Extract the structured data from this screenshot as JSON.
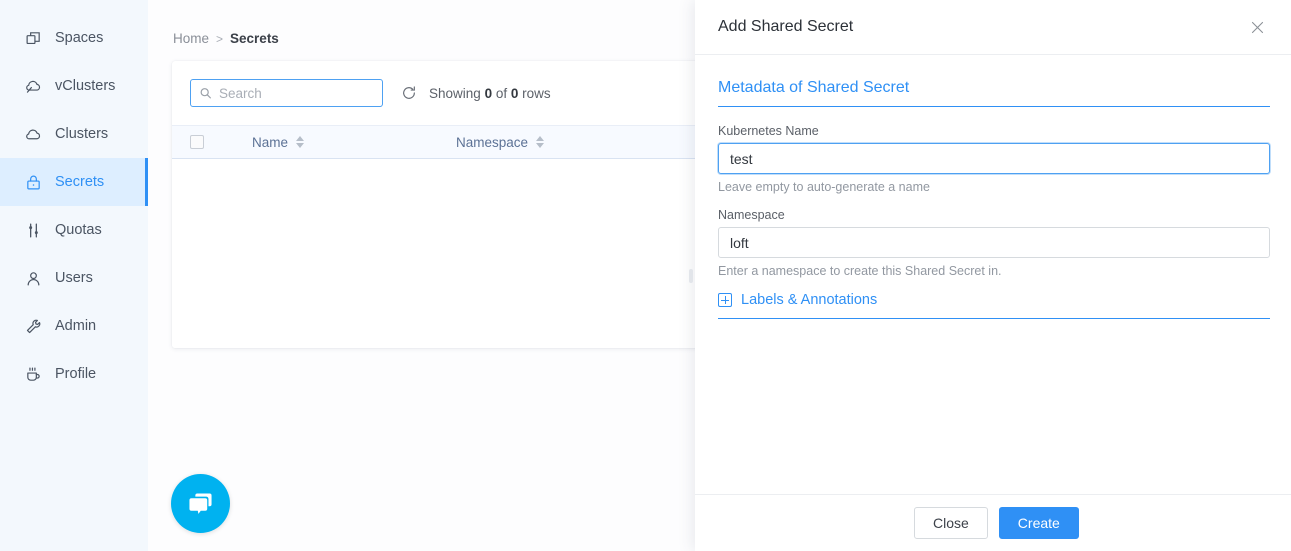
{
  "sidebar": {
    "items": [
      {
        "label": "Spaces",
        "icon": "spaces-icon",
        "active": false
      },
      {
        "label": "vClusters",
        "icon": "vclusters-icon",
        "active": false
      },
      {
        "label": "Clusters",
        "icon": "clusters-icon",
        "active": false
      },
      {
        "label": "Secrets",
        "icon": "lock-icon",
        "active": true
      },
      {
        "label": "Quotas",
        "icon": "sliders-icon",
        "active": false
      },
      {
        "label": "Users",
        "icon": "user-icon",
        "active": false
      },
      {
        "label": "Admin",
        "icon": "wrench-icon",
        "active": false
      },
      {
        "label": "Profile",
        "icon": "coffee-icon",
        "active": false
      }
    ],
    "active_index": 3
  },
  "breadcrumb": {
    "home": "Home",
    "separator": ">",
    "current": "Secrets"
  },
  "toolbar": {
    "search_placeholder": "Search",
    "search_value": "",
    "search_icon": "search-icon",
    "refresh_icon": "refresh-icon",
    "showing_prefix": "Showing",
    "showing_count": "0",
    "showing_of": "of",
    "showing_total": "0",
    "showing_suffix": "rows"
  },
  "table": {
    "columns": [
      {
        "label": "Name"
      },
      {
        "label": "Namespace"
      }
    ],
    "rows": []
  },
  "chat": {
    "icon": "chat-bubble-icon"
  },
  "drawer": {
    "title": "Add Shared Secret",
    "close_icon": "close-icon",
    "section_title": "Metadata of Shared Secret",
    "fields": [
      {
        "label": "Kubernetes Name",
        "value": "test",
        "hint": "Leave empty to auto-generate a name",
        "focused": true
      },
      {
        "label": "Namespace",
        "value": "loft",
        "hint": "Enter a namespace to create this Shared Secret in.",
        "focused": false
      }
    ],
    "labels_toggle": {
      "label": "Labels & Annotations",
      "icon": "plus-box-icon"
    },
    "footer": {
      "close_label": "Close",
      "create_label": "Create"
    }
  },
  "colors": {
    "accent": "#2f90f5",
    "sidebar_bg": "#f3f8fd",
    "sidebar_active_bg": "#ddeeff",
    "chat_bg": "#00b2f0",
    "table_head_bg": "#f7faff",
    "column_header_text": "#5c7296"
  }
}
